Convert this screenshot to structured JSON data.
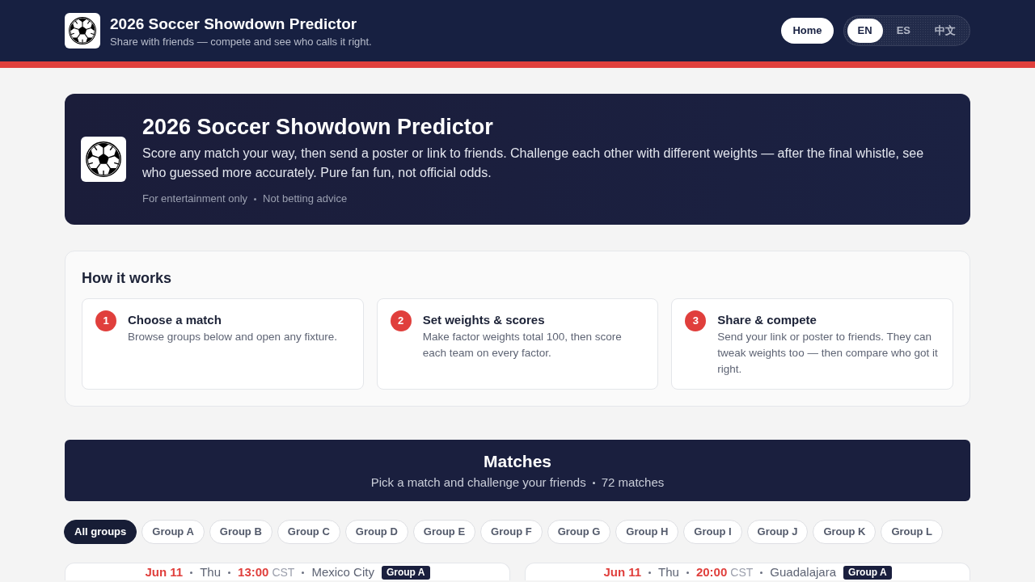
{
  "header": {
    "title": "2026 Soccer Showdown Predictor",
    "subtitle": "Share with friends — compete and see who calls it right.",
    "home_button": "Home",
    "languages": [
      {
        "label": "EN",
        "selected": true
      },
      {
        "label": "ES",
        "selected": false
      },
      {
        "label": "中文",
        "selected": false
      }
    ]
  },
  "hero": {
    "title": "2026 Soccer Showdown Predictor",
    "description": "Score any match your way, then send a poster or link to friends. Challenge each other with different weights — after the final whistle, see who guessed more accurately. Pure fan fun, not official odds.",
    "notes": [
      "For entertainment only",
      "Not betting advice"
    ]
  },
  "how_it_works": {
    "title": "How it works",
    "steps": [
      {
        "number": "1",
        "title": "Choose a match",
        "description": "Browse groups below and open any fixture."
      },
      {
        "number": "2",
        "title": "Set weights & scores",
        "description": "Make factor weights total 100, then score each team on every factor."
      },
      {
        "number": "3",
        "title": "Share & compete",
        "description": "Send your link or poster to friends. They can tweak weights too — then compare who got it right."
      }
    ]
  },
  "matches": {
    "title": "Matches",
    "subtitle": "Pick a match and challenge your friends",
    "count": "72 matches"
  },
  "group_filters": [
    {
      "label": "All groups",
      "selected": true
    },
    {
      "label": "Group A",
      "selected": false
    },
    {
      "label": "Group B",
      "selected": false
    },
    {
      "label": "Group C",
      "selected": false
    },
    {
      "label": "Group D",
      "selected": false
    },
    {
      "label": "Group E",
      "selected": false
    },
    {
      "label": "Group F",
      "selected": false
    },
    {
      "label": "Group G",
      "selected": false
    },
    {
      "label": "Group H",
      "selected": false
    },
    {
      "label": "Group I",
      "selected": false
    },
    {
      "label": "Group J",
      "selected": false
    },
    {
      "label": "Group K",
      "selected": false
    },
    {
      "label": "Group L",
      "selected": false
    }
  ],
  "match_cards": [
    {
      "date": "Jun 11",
      "weekday": "Thu",
      "time": "13:00",
      "timezone": "CST",
      "city": "Mexico City",
      "group": "Group A"
    },
    {
      "date": "Jun 11",
      "weekday": "Thu",
      "time": "20:00",
      "timezone": "CST",
      "city": "Guadalajara",
      "group": "Group A"
    }
  ]
}
